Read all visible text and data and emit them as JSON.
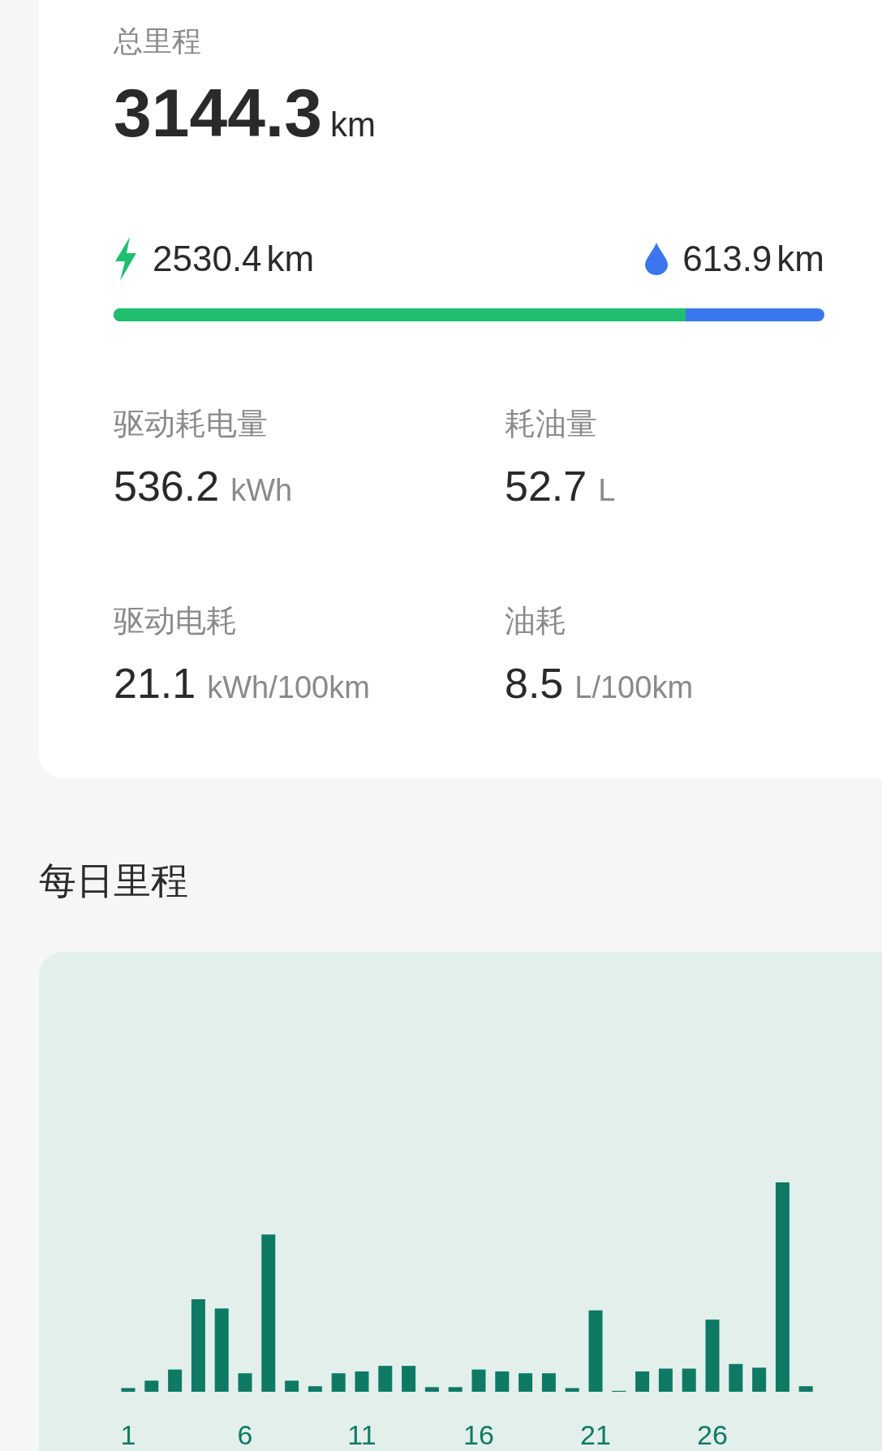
{
  "summary": {
    "title": "总里程",
    "total_value": "3144.3",
    "total_unit": "km",
    "electric": {
      "value": "2530.4",
      "unit": "km"
    },
    "fuel": {
      "value": "613.9",
      "unit": "km"
    },
    "split": {
      "level": 0.805
    },
    "stats": [
      {
        "label": "驱动耗电量",
        "value": "536.2",
        "unit": "kWh"
      },
      {
        "label": "耗油量",
        "value": "52.7",
        "unit": "L"
      },
      {
        "label": "驱动电耗",
        "value": "21.1",
        "unit": "kWh/100km"
      },
      {
        "label": "油耗",
        "value": "8.5",
        "unit": "L/100km"
      }
    ]
  },
  "daily": {
    "title": "每日里程",
    "x_labels": [
      "1",
      "6",
      "11",
      "16",
      "21",
      "26"
    ]
  }
}
